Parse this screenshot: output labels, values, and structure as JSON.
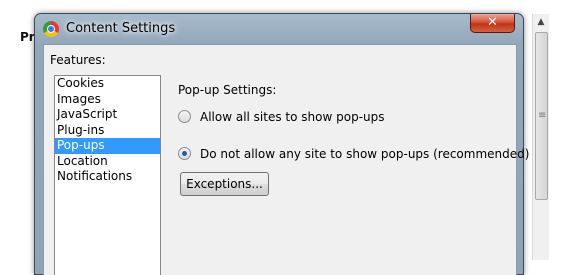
{
  "background": {
    "page_prefix": "Pri"
  },
  "window": {
    "title": "Content Settings",
    "close_glyph": "✕",
    "app_icon": "chrome-logo-icon"
  },
  "features": {
    "label": "Features:",
    "items": [
      "Cookies",
      "Images",
      "JavaScript",
      "Plug-ins",
      "Pop-ups",
      "Location",
      "Notifications"
    ],
    "selected": "Pop-ups"
  },
  "popup_settings": {
    "heading": "Pop-up Settings:",
    "options": [
      {
        "label": "Allow all sites to show pop-ups",
        "checked": false
      },
      {
        "label": "Do not allow any site to show pop-ups (recommended)",
        "checked": true
      }
    ],
    "exceptions_button": "Exceptions..."
  },
  "colors": {
    "selection": "#3399ff",
    "titlebar": "#a8bbcc",
    "close_button": "#c23316"
  }
}
